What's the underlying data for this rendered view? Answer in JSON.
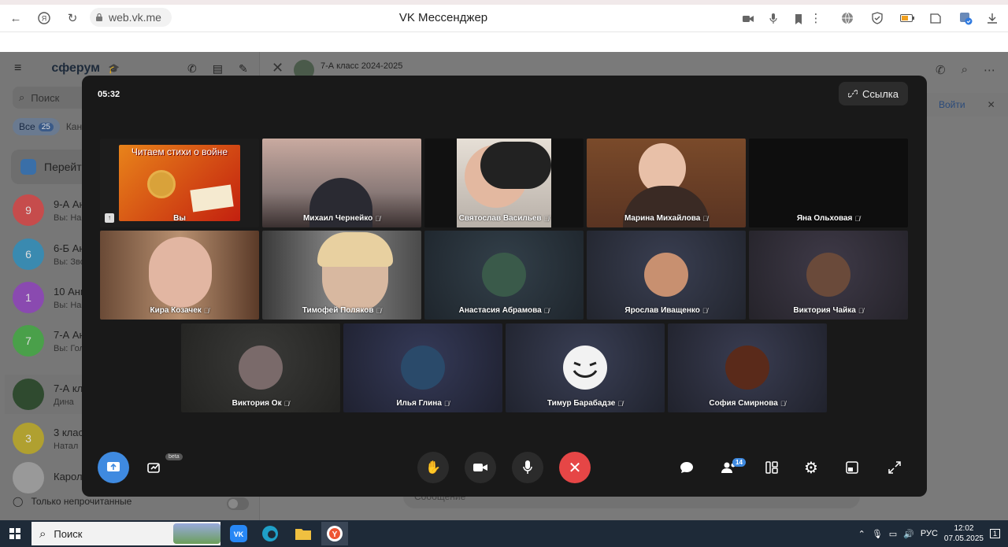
{
  "browser": {
    "url": "web.vk.me",
    "title": "VK Мессенджер"
  },
  "sidebar": {
    "brand": "сферум",
    "search_placeholder": "Поиск",
    "filter_all": "Все",
    "filter_all_count": "25",
    "filter_second": "Кан",
    "goto": "Перейт",
    "chats": [
      {
        "avatar": "9",
        "color": "#c64c4c",
        "title": "9-А Ан",
        "preview": "Вы: На"
      },
      {
        "avatar": "6",
        "color": "#3a8ab0",
        "title": "6-Б Ан",
        "preview": "Вы: Зво"
      },
      {
        "avatar": "1",
        "color": "#8a4ab0",
        "title": "10 Анг",
        "preview": "Вы: На"
      },
      {
        "avatar": "7",
        "color": "#4aa04a",
        "title": "7-А Ан",
        "preview": "Вы: Гол"
      },
      {
        "avatar": "",
        "color": "#2f4a2f",
        "title": "7-А кл",
        "preview": "Дина"
      },
      {
        "avatar": "3",
        "color": "#b0a030",
        "title": "3 клас",
        "preview": "Натал"
      },
      {
        "avatar": "",
        "color": "#999999",
        "title": "Карол",
        "preview": ""
      }
    ],
    "unread_only": "Только непрочитанные"
  },
  "chat": {
    "group_title": "7-А класс 2024-2025",
    "join_label": "Войти",
    "message_placeholder": "Сообщение"
  },
  "call": {
    "timer": "05:32",
    "link_label": "Ссылка",
    "banner_text": "Читаем стихи о войне",
    "participants": [
      {
        "name": "Вы",
        "kind": "banner",
        "muted": false
      },
      {
        "name": "Михаил Чернейко",
        "kind": "video",
        "muted": true,
        "color": "#8a7a78"
      },
      {
        "name": "Святослав Васильев",
        "kind": "video",
        "muted": true,
        "color": "#b8b0a8"
      },
      {
        "name": "Марина Михайлова",
        "kind": "video",
        "muted": true,
        "color": "#6a4a34"
      },
      {
        "name": "Яна Ольховая",
        "kind": "black",
        "muted": true
      },
      {
        "name": "Кира Козачек",
        "kind": "video",
        "muted": true,
        "color": "#7a5a42"
      },
      {
        "name": "Тимофей Поляков",
        "kind": "video",
        "muted": true,
        "color": "#6a6a6a"
      },
      {
        "name": "Анастасия Абрамова",
        "kind": "avatar",
        "muted": true,
        "color": "#3a5a4a"
      },
      {
        "name": "Ярослав Иващенко",
        "kind": "avatar",
        "muted": true,
        "color": "#c89070"
      },
      {
        "name": "Виктория Чайка",
        "kind": "avatar",
        "muted": true,
        "color": "#6a4a3a"
      },
      {
        "name": "Виктория Ок",
        "kind": "avatar",
        "muted": true,
        "color": "#7a6a6a"
      },
      {
        "name": "Илья Глина",
        "kind": "avatar",
        "muted": true,
        "color": "#2a4a6a"
      },
      {
        "name": "Тимур Барабадзе",
        "kind": "avatar",
        "muted": true,
        "color": "#f2f2f2"
      },
      {
        "name": "София Смирнова",
        "kind": "avatar",
        "muted": true,
        "color": "#5a2a1a"
      }
    ],
    "beta_label": "beta",
    "participants_count": "14"
  },
  "taskbar": {
    "search_label": "Поиск",
    "language": "РУС",
    "time": "12:02",
    "date": "07.05.2025",
    "notification_count": "1"
  }
}
